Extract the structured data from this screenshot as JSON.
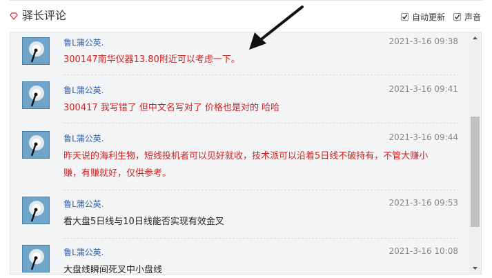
{
  "header": {
    "title": "驿长评论",
    "options": [
      {
        "label": "自动更新",
        "checked": true
      },
      {
        "label": "声音",
        "checked": true
      }
    ]
  },
  "comments": [
    {
      "user": "鲁L蒲公英.",
      "time": "2021-3-16 09:38",
      "lines": [
        "300147南华仪器13.80附近可以考虑一下。"
      ],
      "color": "red"
    },
    {
      "user": "鲁L蒲公英.",
      "time": "2021-3-16 09:41",
      "lines": [
        "300417  我写错了  但中文名写对了   价格也是对的  哈哈"
      ],
      "color": "red"
    },
    {
      "user": "鲁L蒲公英.",
      "time": "2021-3-16 09:44",
      "lines": [
        "昨天说的海利生物，短线投机者可以见好就收，技术派可以沿着5日线不破持有，不管大赚小",
        "赚，有赚就好，仅供参考。"
      ],
      "color": "red"
    },
    {
      "user": "鲁L蒲公英.",
      "time": "2021-3-16 09:53",
      "lines": [
        "看大盘5日线与10日线能否实现有效金叉"
      ],
      "color": "dark"
    },
    {
      "user": "鲁L蒲公英.",
      "time": "2021-3-16 10:08",
      "lines": [
        "大盘线瞬间死叉中小盘线"
      ],
      "color": "dark"
    }
  ],
  "icons": {
    "title_icon": "diamond-outline-icon",
    "avatar": "dandelion-avatar-icon",
    "scroll_up": "triangle-up-icon",
    "scroll_down": "triangle-down-icon",
    "annotation": "black-arrow-icon"
  },
  "colors": {
    "accent_red": "#cc2222",
    "username_blue": "#3060a8",
    "time_gray": "#888888",
    "panel_bg": "#f3f4f6"
  }
}
